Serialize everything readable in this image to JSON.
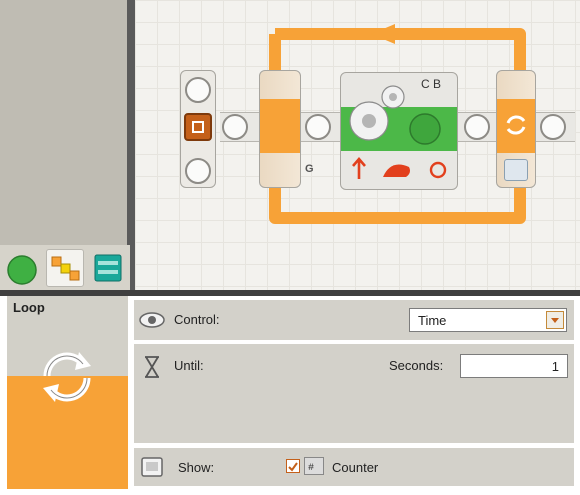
{
  "palette": {
    "tabs": [
      {
        "name": "common-palette",
        "color": "#3fb043"
      },
      {
        "name": "complete-palette",
        "color": "#f39c12"
      },
      {
        "name": "custom-palette",
        "color": "#1aa89a"
      }
    ]
  },
  "canvas": {
    "motor_block": {
      "ports": "C B"
    },
    "loop_badge": "G"
  },
  "panel": {
    "block_title": "Loop",
    "control": {
      "label": "Control:",
      "value": "Time"
    },
    "until": {
      "label": "Until:",
      "seconds_label": "Seconds:",
      "seconds_value": "1"
    },
    "show": {
      "label": "Show:",
      "option_label": "Counter",
      "checked": true
    }
  },
  "colors": {
    "accent": "#f7a237",
    "green": "#4cb848"
  }
}
